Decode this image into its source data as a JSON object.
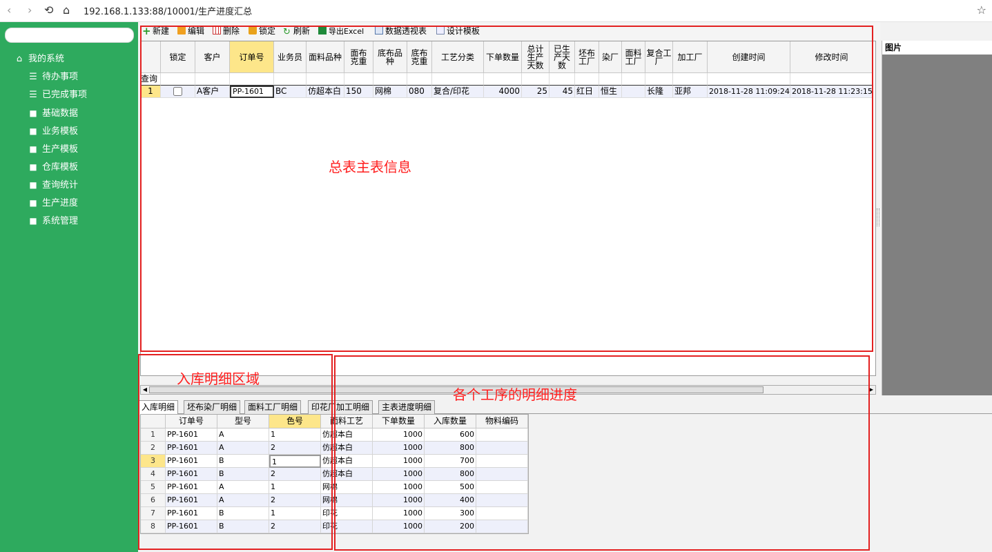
{
  "browser": {
    "url": "192.168.1.133:88/10001/生产进度汇总"
  },
  "sidebar": {
    "search_placeholder": "",
    "root": "我的系统",
    "items": [
      {
        "label": "待办事项",
        "icon": "list-icon"
      },
      {
        "label": "已完成事项",
        "icon": "list-icon"
      },
      {
        "label": "基础数据",
        "icon": "folder-icon"
      },
      {
        "label": "业务模板",
        "icon": "folder-icon"
      },
      {
        "label": "生产模板",
        "icon": "folder-icon"
      },
      {
        "label": "仓库模板",
        "icon": "folder-icon"
      },
      {
        "label": "查询统计",
        "icon": "folder-icon"
      },
      {
        "label": "生产进度",
        "icon": "folder-icon"
      },
      {
        "label": "系统管理",
        "icon": "folder-icon"
      }
    ]
  },
  "toolbar": {
    "new": "新建",
    "edit": "编辑",
    "delete": "删除",
    "lock": "锁定",
    "refresh": "刷新",
    "export": "导出Excel",
    "pivot": "数据透视表",
    "design": "设计模板"
  },
  "main_grid": {
    "query_label": "查询",
    "headers": [
      "锁定",
      "客户",
      "订单号",
      "业务员",
      "面料品种",
      "面布克重",
      "底布品种",
      "底布克重",
      "工艺分类",
      "下单数量",
      "总计生产天数",
      "已生产天数",
      "坯布工厂",
      "染厂",
      "面料工厂",
      "复合工厂",
      "加工厂",
      "创建时间",
      "修改时间"
    ],
    "header_lines": [
      [
        "锁定"
      ],
      [
        "客户"
      ],
      [
        "订单号"
      ],
      [
        "业务员"
      ],
      [
        "面料品种"
      ],
      [
        "面布",
        "克重"
      ],
      [
        "底布品",
        "种"
      ],
      [
        "底布",
        "克重"
      ],
      [
        "工艺分类"
      ],
      [
        "下单数量"
      ],
      [
        "总计",
        "生产",
        "天数"
      ],
      [
        "已生",
        "产天",
        "数"
      ],
      [
        "坯布",
        "工厂"
      ],
      [
        "染厂"
      ],
      [
        "面料",
        "工厂"
      ],
      [
        "复合工",
        "厂"
      ],
      [
        "加工厂"
      ],
      [
        "创建时间"
      ],
      [
        "修改时间"
      ]
    ],
    "rows": [
      {
        "no": "1",
        "locked": false,
        "customer": "A客户",
        "order": "PP-1601",
        "sales": "BC",
        "fabric": "仿超本白",
        "face_weight": "150",
        "base_fabric": "网棉",
        "base_weight": "080",
        "process": "复合/印花",
        "qty": "4000",
        "total_days": "25",
        "done_days": "45",
        "grey_factory": "红日",
        "dye_factory": "恒生",
        "fabric_factory": "",
        "composite_factory": "长隆",
        "processor": "亚邦",
        "created": "2018-11-28 11:09:24",
        "modified": "2018-11-28 11:23:15"
      }
    ]
  },
  "image_panel": {
    "title": "图片"
  },
  "annotations": {
    "main": "总表主表信息",
    "inbound": "入库明细区域",
    "process": "各个工序的明细进度"
  },
  "tabs": [
    "入库明细",
    "坯布染厂明细",
    "面料工厂明细",
    "印花厂加工明细",
    "主表进度明细"
  ],
  "detail_grid": {
    "headers": [
      "订单号",
      "型号",
      "色号",
      "面料工艺",
      "下单数量",
      "入库数量",
      "物料编码"
    ],
    "rows": [
      [
        "1",
        "PP-1601",
        "A",
        "1",
        "仿超本白",
        "1000",
        "600",
        ""
      ],
      [
        "2",
        "PP-1601",
        "A",
        "2",
        "仿超本白",
        "1000",
        "800",
        ""
      ],
      [
        "3",
        "PP-1601",
        "B",
        "1",
        "仿超本白",
        "1000",
        "700",
        ""
      ],
      [
        "4",
        "PP-1601",
        "B",
        "2",
        "仿超本白",
        "1000",
        "800",
        ""
      ],
      [
        "5",
        "PP-1601",
        "A",
        "1",
        "网棉",
        "1000",
        "500",
        ""
      ],
      [
        "6",
        "PP-1601",
        "A",
        "2",
        "网棉",
        "1000",
        "400",
        ""
      ],
      [
        "7",
        "PP-1601",
        "B",
        "1",
        "印花",
        "1000",
        "300",
        ""
      ],
      [
        "8",
        "PP-1601",
        "B",
        "2",
        "印花",
        "1000",
        "200",
        ""
      ]
    ]
  },
  "colors": {
    "sidebar": "#2eaa5e",
    "highlight": "#fde68a",
    "annotation": "#e32020"
  }
}
